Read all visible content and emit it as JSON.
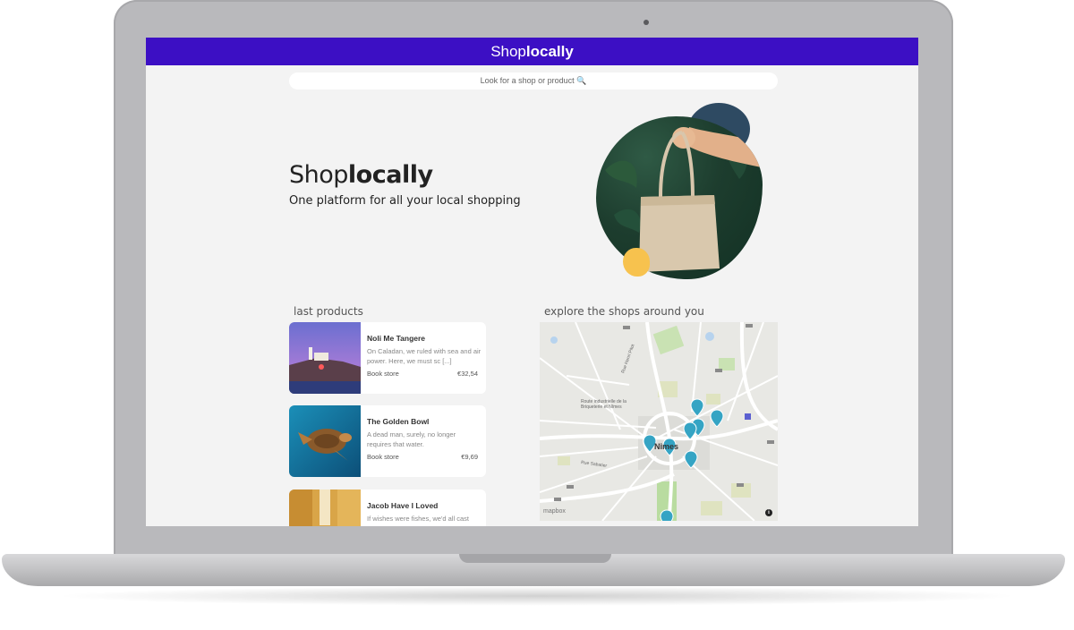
{
  "header": {
    "brand_light": "Shop",
    "brand_bold": "locally"
  },
  "search": {
    "text": "Look for a shop or product 🔍"
  },
  "hero": {
    "title_light": "Shop",
    "title_bold": "locally",
    "subtitle": "One platform for all your local shopping"
  },
  "sections": {
    "products_title": "last products",
    "map_title": "explore the shops around you"
  },
  "products": [
    {
      "name": "Noli Me Tangere",
      "desc": "On Caladan, we ruled with sea and air power. Here, we must sc [...]",
      "store": "Book store",
      "price": "€32,54"
    },
    {
      "name": "The Golden Bowl",
      "desc": "A dead man, surely, no longer requires that water.",
      "store": "Book store",
      "price": "€9,69"
    },
    {
      "name": "Jacob Have I Loved",
      "desc": "If wishes were fishes, we'd all cast nets.",
      "store": "",
      "price": ""
    }
  ],
  "map": {
    "city": "Nîmes",
    "labels": [
      "Rue Henri Pitot",
      "Route industrielle de la Briqueterie et Nîmes",
      "Rue Sabatier",
      "D99",
      "N113",
      "D999",
      "D13",
      "D40",
      "N106",
      "D27",
      "D42"
    ],
    "attribution": "mapbox",
    "info": "i",
    "colors": {
      "pin": "#35a4c4",
      "park": "#c9e2b3",
      "road": "#ffffff",
      "highway": "#f7d77a"
    }
  },
  "colors": {
    "brand": "#3c0fc4",
    "accent_dark": "#2e4a62",
    "accent_yellow": "#f7c24e",
    "background": "#f3f3f3"
  }
}
